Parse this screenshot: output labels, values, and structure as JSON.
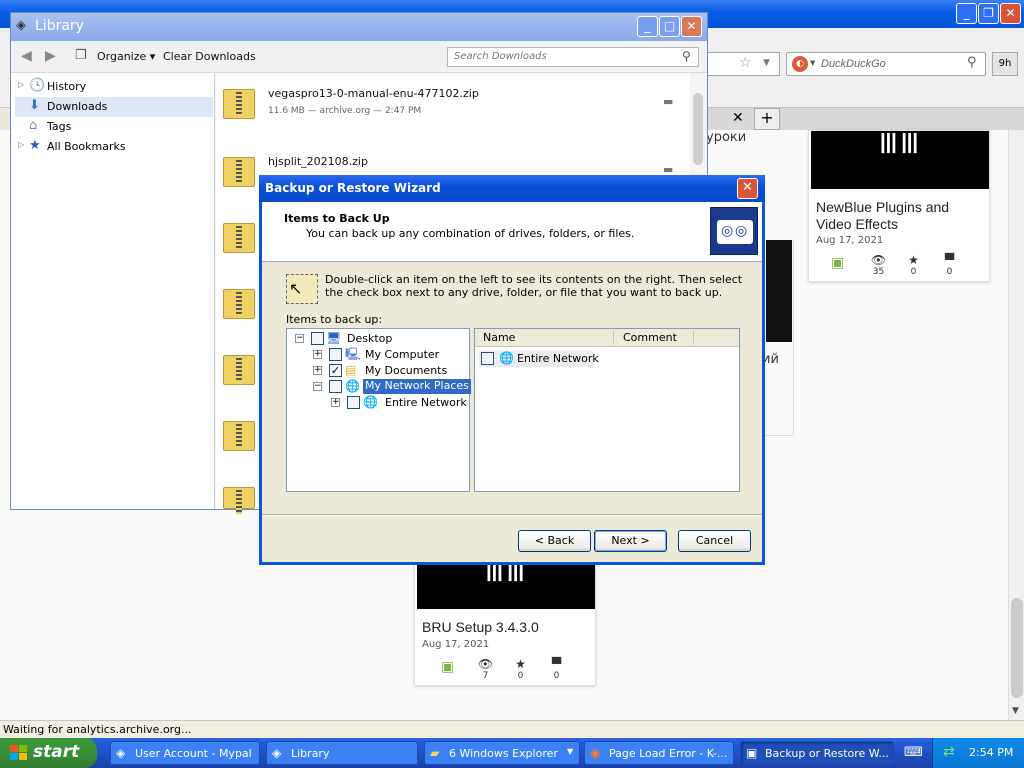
{
  "firefox": {
    "search_placeholder": "DuckDuckGo",
    "ext_label": "9h",
    "status_text": "Waiting for analytics.archive.org...",
    "partial_text_1": "уроки",
    "partial_text_2": "ий"
  },
  "cards": [
    {
      "title": "NewBlue Plugins and Video Effects",
      "date": "Aug 17, 2021",
      "views": "35",
      "favs": "0",
      "comments": "0"
    },
    {
      "title": "BRU Setup 3.4.3.0",
      "date": "Aug 17, 2021",
      "views": "7",
      "favs": "0",
      "comments": "0"
    }
  ],
  "library": {
    "title": "Library",
    "organize_label": "Organize",
    "clear_downloads_label": "Clear Downloads",
    "search_placeholder": "Search Downloads",
    "sidebar": [
      {
        "label": "History",
        "icon": "clock-icon"
      },
      {
        "label": "Downloads",
        "icon": "download-arrow-icon"
      },
      {
        "label": "Tags",
        "icon": "tag-icon"
      },
      {
        "label": "All Bookmarks",
        "icon": "star-icon"
      }
    ],
    "downloads": [
      {
        "name": "vegaspro13-0-manual-enu-477102.zip",
        "meta": "11.6 MB — archive.org — 2:47 PM"
      },
      {
        "name": "hjsplit_202108.zip",
        "meta": ""
      }
    ]
  },
  "wizard": {
    "title": "Backup or Restore Wizard",
    "heading": "Items to Back Up",
    "subheading": "You can back up any combination of drives, folders, or files.",
    "instructions": "Double-click an item on the left to see its contents on the right. Then select the check box next to any drive, folder, or file that you want to back up.",
    "items_label": "Items to back up:",
    "tree": [
      {
        "label": "Desktop",
        "checked": false,
        "selected": false
      },
      {
        "label": "My Computer",
        "checked": false,
        "selected": false
      },
      {
        "label": "My Documents",
        "checked": true,
        "selected": false
      },
      {
        "label": "My Network Places",
        "checked": false,
        "selected": true
      },
      {
        "label": "Entire Network",
        "checked": false,
        "selected": false
      }
    ],
    "list_columns": [
      "Name",
      "Comment"
    ],
    "list_items": [
      {
        "name": "Entire Network"
      }
    ],
    "back_label": "< Back",
    "next_label": "Next >",
    "cancel_label": "Cancel"
  },
  "taskbar": {
    "start_label": "start",
    "tasks": [
      {
        "label": "User Account - Mypal"
      },
      {
        "label": "Library"
      },
      {
        "label": "6 Windows Explorer"
      },
      {
        "label": "Page Load Error - K-..."
      },
      {
        "label": "Backup or Restore W..."
      }
    ],
    "clock": "2:54 PM"
  },
  "colors": {
    "xp_blue": "#0a55d8",
    "start_green": "#388e38",
    "selection": "#316ac5"
  }
}
